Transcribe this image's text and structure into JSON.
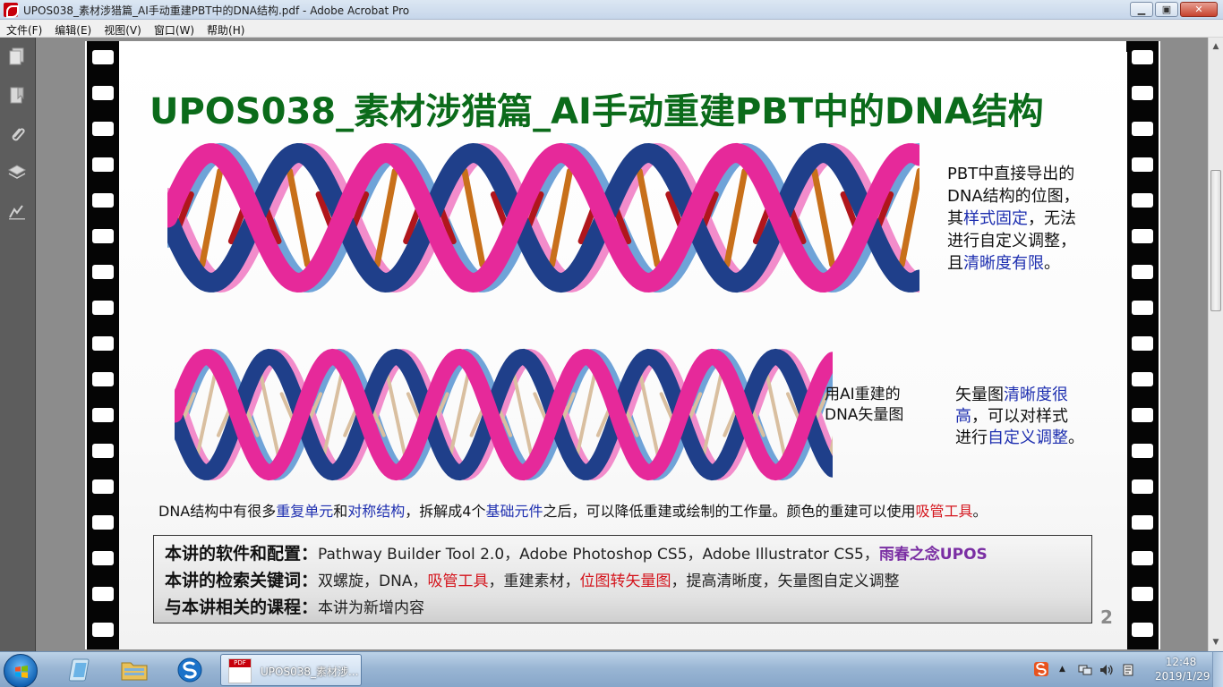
{
  "window": {
    "title": "UPOS038_素材涉猎篇_AI手动重建PBT中的DNA结构.pdf - Adobe Acrobat Pro",
    "minimize": "▁",
    "maximize": "▣",
    "close": "✕"
  },
  "menu": [
    {
      "label": "文件(F)"
    },
    {
      "label": "编辑(E)"
    },
    {
      "label": "视图(V)"
    },
    {
      "label": "窗口(W)"
    },
    {
      "label": "帮助(H)"
    }
  ],
  "nav_icons": [
    "pages-icon",
    "bookmark-icon",
    "attachment-icon",
    "layers-icon",
    "signature-icon"
  ],
  "slide": {
    "title": "UPOS038_素材涉猎篇_AI手动重建PBT中的DNA结构",
    "note1": {
      "l1": "PBT中直接导出的",
      "l2": "DNA结构的位图，",
      "l3a": "其",
      "l3b": "样式固定",
      "l3c": "，无法",
      "l4": "进行自定义调整，",
      "l5a": "且",
      "l5b": "清晰度有限",
      "l5c": "。"
    },
    "note2": {
      "l1": "用AI重建的",
      "l2": "DNA矢量图"
    },
    "note3": {
      "l1a": "矢量图",
      "l1b": "清晰度很",
      "l2a": "高",
      "l2b": "，可以对样式",
      "l3a": "进行",
      "l3b": "自定义调整",
      "l3c": "。"
    },
    "summary": {
      "p1": "DNA结构中有很多",
      "p2": "重复单元",
      "p3": "和",
      "p4": "对称结构",
      "p5": "，拆解成4个",
      "p6": "基础元件",
      "p7": "之后，可以降低重建或绘制的工作量。颜色的重建可以使用",
      "p8": "吸管工具",
      "p9": "。"
    },
    "info": {
      "r1_label": "本讲的软件和配置",
      "r1_colon": "：",
      "r1_text": "Pathway Builder Tool 2.0，Adobe Photoshop CS5，Adobe Illustrator CS5，",
      "r1_brand": "雨春之念UPOS",
      "r2_label": "本讲的检索关键词",
      "r2_colon": "：",
      "r2_t1": "双螺旋，DNA，",
      "r2_t2": "吸管工具",
      "r2_t3": "，重建素材，",
      "r2_t4": "位图转矢量图",
      "r2_t5": "，提高清晰度，矢量图自定义调整",
      "r3_label": "与本讲相关的课程",
      "r3_colon": "：",
      "r3_text": "本讲为新增内容"
    },
    "page_number": "2"
  },
  "colors": {
    "title_green": "#0b6b1a",
    "highlight_blue": "#1e2fb0",
    "highlight_red": "#d4141c",
    "brand_purple": "#7a2ea3",
    "helix_navy": "#1f3f8a",
    "helix_pink": "#e6299a",
    "helix_light_blue": "#6fa3d8",
    "helix_light_pink": "#f28ccb",
    "rung_red": "#b0161c",
    "rung_orange": "#c8701a",
    "rung_tan": "#d9bfa0"
  },
  "taskbar": {
    "task_label": "UPOS038_素材涉...",
    "time": "12:48",
    "date": "2019/1/29"
  }
}
